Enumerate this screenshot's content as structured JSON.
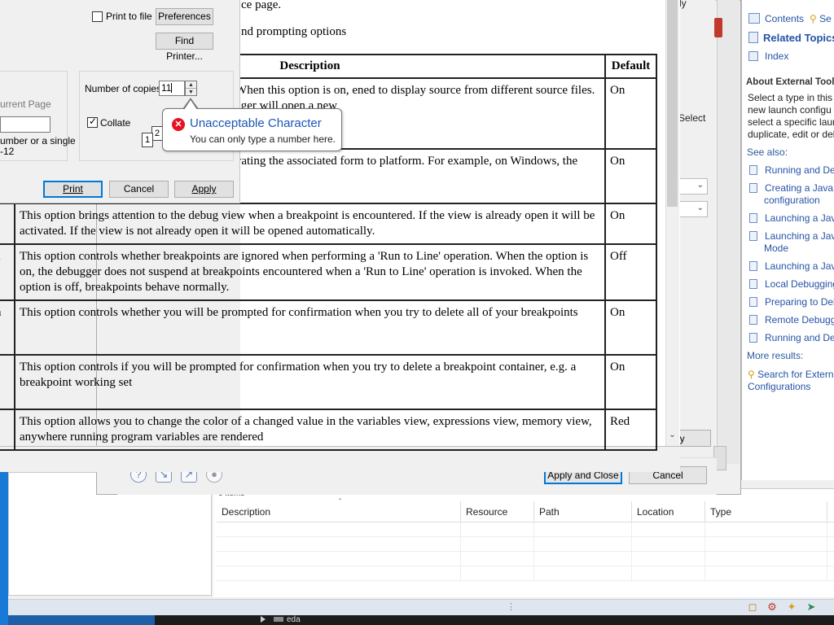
{
  "print_dialog": {
    "print_to_file_label": "Print to file",
    "preferences_label": "Preferences",
    "find_printer_label": "Find Printer...",
    "current_page_label": "urrent Page",
    "pages_hint_line1": "umber or a single",
    "pages_hint_line2": "-12",
    "copies_label": "Number of copies:",
    "copies_value": "11",
    "collate_label": "Collate",
    "collate_pages": [
      "1",
      "2"
    ],
    "print_button": "Print",
    "cancel_button": "Cancel",
    "apply_button": "Apply"
  },
  "tooltip": {
    "title": "Unacceptable Character",
    "body": "You can only type a number here.",
    "icon": "error-icon"
  },
  "document": {
    "line1": "ce page.",
    "line2": "nd prompting options",
    "table_header": {
      "description": "Description",
      "default": "Default"
    },
    "rows": [
      {
        "c0": "",
        "desc": "ditor when stepping through an application. When this option is on, ened to display source from different source files. This prevents the this option is off, the debugger will open a new",
        "def": "On"
      },
      {
        "c0": "",
        "desc": "er when a breakpoint is encountered, by activating the associated form to platform. For example, on Windows, the associated",
        "def": "On"
      },
      {
        "c0": "",
        "desc": "This option brings attention to the debug view when a breakpoint is encountered. If the view is already open it will be activated. If the view is not already open it will be opened automatically.",
        "def": "On"
      },
      {
        "c0": "a",
        "desc": "This option controls whether breakpoints are ignored when performing a 'Run to Line' operation. When the option is on, the debugger does not suspend at breakpoints encountered when a 'Run to Line' operation is invoked. When the option is off, breakpoints behave normally.",
        "def": "Off"
      },
      {
        "c0": "n",
        "desc": "This option controls whether you will be prompted for confirmation when you try to delete all of your breakpoints",
        "def": "On"
      },
      {
        "c0": "t",
        "desc": "This option controls if you will be prompted for confirmation when you try to delete a breakpoint container, e.g. a breakpoint working set",
        "def": "On"
      },
      {
        "c0": "",
        "desc": "This option allows you to change the color of a changed value in the variables view, expressions view, memory view, anywhere running program variables are rendered",
        "def": "Red"
      }
    ]
  },
  "launch_dialog": {
    "partial_ly": "ly",
    "select_text": "Select",
    "ly_button": "ly",
    "apply_close_button": "Apply and Close",
    "cancel_button": "Cancel"
  },
  "help_panel": {
    "tab_contents": "Contents",
    "tab_search": "Se",
    "related_topics": "Related Topics",
    "index": "Index",
    "about_heading": "About External Tool",
    "about_lines": [
      "Select a type in this t",
      "new launch configu",
      "select a specific laun",
      "duplicate, edit or del"
    ],
    "see_also": "See also:",
    "links": [
      "Running and De",
      "Creating a Java a",
      "configuration",
      "Launching a Java",
      "Launching a Java",
      "Mode",
      "Launching a Java",
      "Local Debugging",
      "Preparing to Deb",
      "Remote Debugg",
      "Running and De"
    ],
    "more_results": "More results:",
    "search_line1": "Search for Extern",
    "search_line2": "Configurations"
  },
  "problems_view": {
    "item_count": "0 items",
    "columns": [
      "Description",
      "Resource",
      "Path",
      "Location",
      "Type"
    ]
  },
  "taskbar": {
    "item_label": "eda"
  },
  "colors": {
    "accent": "#0078d7",
    "error": "#e81123",
    "link": "#2453a7"
  }
}
